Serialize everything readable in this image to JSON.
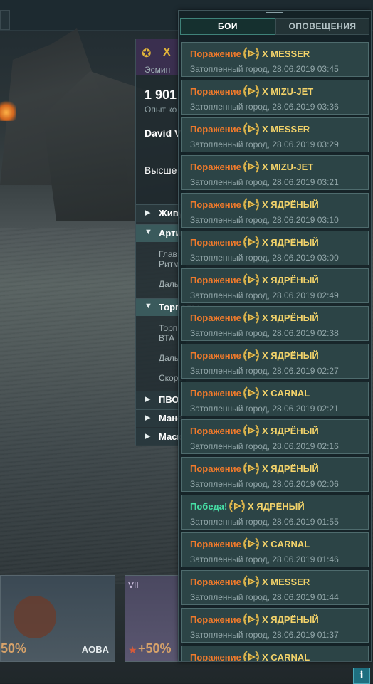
{
  "ship_panel": {
    "tier": "X",
    "class_prefix": "Эсмин",
    "exp_value": "1 901",
    "exp_label": "Опыт ко",
    "captain": "David V",
    "higher": "Высше",
    "sections": [
      {
        "arrow": "▶",
        "label": "Живу"
      },
      {
        "arrow": "▼",
        "label": "Артил"
      },
      {
        "arrow": "▼",
        "label": "Торпеды"
      },
      {
        "arrow": "▶",
        "label": "ПВО"
      },
      {
        "arrow": "▶",
        "label": "Манё"
      },
      {
        "arrow": "▶",
        "label": "Маск"
      }
    ],
    "sub_items": [
      "Глав",
      "Ритм",
      "Даль",
      "Торп",
      "ВТА",
      "Даль",
      "Скоро"
    ]
  },
  "bottom_cards": [
    {
      "pct": "50%",
      "name": "AOBA"
    },
    {
      "tier": "VII",
      "pct": "+50%"
    }
  ],
  "notifications": {
    "tabs": [
      {
        "label": "БОИ",
        "active": true
      },
      {
        "label": "ОПОВЕЩЕНИЯ",
        "active": false
      }
    ],
    "entries": [
      {
        "result": "Поражение",
        "outcome": "loss",
        "tier": "X",
        "ship": "MESSER",
        "map": "Затопленный город",
        "datetime": "28.06.2019 03:45"
      },
      {
        "result": "Поражение",
        "outcome": "loss",
        "tier": "X",
        "ship": "MIZU-JET",
        "map": "Затопленный город",
        "datetime": "28.06.2019 03:36"
      },
      {
        "result": "Поражение",
        "outcome": "loss",
        "tier": "X",
        "ship": "MESSER",
        "map": "Затопленный город",
        "datetime": "28.06.2019 03:29"
      },
      {
        "result": "Поражение",
        "outcome": "loss",
        "tier": "X",
        "ship": "MIZU-JET",
        "map": "Затопленный город",
        "datetime": "28.06.2019 03:21"
      },
      {
        "result": "Поражение",
        "outcome": "loss",
        "tier": "X",
        "ship": "ЯДРЁНЫЙ",
        "map": "Затопленный город",
        "datetime": "28.06.2019 03:10"
      },
      {
        "result": "Поражение",
        "outcome": "loss",
        "tier": "X",
        "ship": "ЯДРЁНЫЙ",
        "map": "Затопленный город",
        "datetime": "28.06.2019 03:00"
      },
      {
        "result": "Поражение",
        "outcome": "loss",
        "tier": "X",
        "ship": "ЯДРЁНЫЙ",
        "map": "Затопленный город",
        "datetime": "28.06.2019 02:49"
      },
      {
        "result": "Поражение",
        "outcome": "loss",
        "tier": "X",
        "ship": "ЯДРЁНЫЙ",
        "map": "Затопленный город",
        "datetime": "28.06.2019 02:38"
      },
      {
        "result": "Поражение",
        "outcome": "loss",
        "tier": "X",
        "ship": "ЯДРЁНЫЙ",
        "map": "Затопленный город",
        "datetime": "28.06.2019 02:27"
      },
      {
        "result": "Поражение",
        "outcome": "loss",
        "tier": "X",
        "ship": "CARNAL",
        "map": "Затопленный город",
        "datetime": "28.06.2019 02:21"
      },
      {
        "result": "Поражение",
        "outcome": "loss",
        "tier": "X",
        "ship": "ЯДРЁНЫЙ",
        "map": "Затопленный город",
        "datetime": "28.06.2019 02:16"
      },
      {
        "result": "Поражение",
        "outcome": "loss",
        "tier": "X",
        "ship": "ЯДРЁНЫЙ",
        "map": "Затопленный город",
        "datetime": "28.06.2019 02:06"
      },
      {
        "result": "Победа!",
        "outcome": "win",
        "tier": "X",
        "ship": "ЯДРЁНЫЙ",
        "map": "Затопленный город",
        "datetime": "28.06.2019 01:55"
      },
      {
        "result": "Поражение",
        "outcome": "loss",
        "tier": "X",
        "ship": "CARNAL",
        "map": "Затопленный город",
        "datetime": "28.06.2019 01:46"
      },
      {
        "result": "Поражение",
        "outcome": "loss",
        "tier": "X",
        "ship": "MESSER",
        "map": "Затопленный город",
        "datetime": "28.06.2019 01:44"
      },
      {
        "result": "Поражение",
        "outcome": "loss",
        "tier": "X",
        "ship": "ЯДРЁНЫЙ",
        "map": "Затопленный город",
        "datetime": "28.06.2019 01:37"
      },
      {
        "result": "Поражение",
        "outcome": "loss",
        "tier": "X",
        "ship": "CARNAL",
        "map": "",
        "datetime": ""
      }
    ]
  },
  "info_button": {
    "glyph": "i"
  },
  "colors": {
    "loss": "#f07a2b",
    "win": "#46e0a6",
    "ship_name": "#f3d36a",
    "entry_bg": "#2c4446",
    "panel_bg": "#142226"
  },
  "icons": {
    "tier_emblem": "laurel-wreath-flag-icon",
    "info": "info-icon"
  }
}
